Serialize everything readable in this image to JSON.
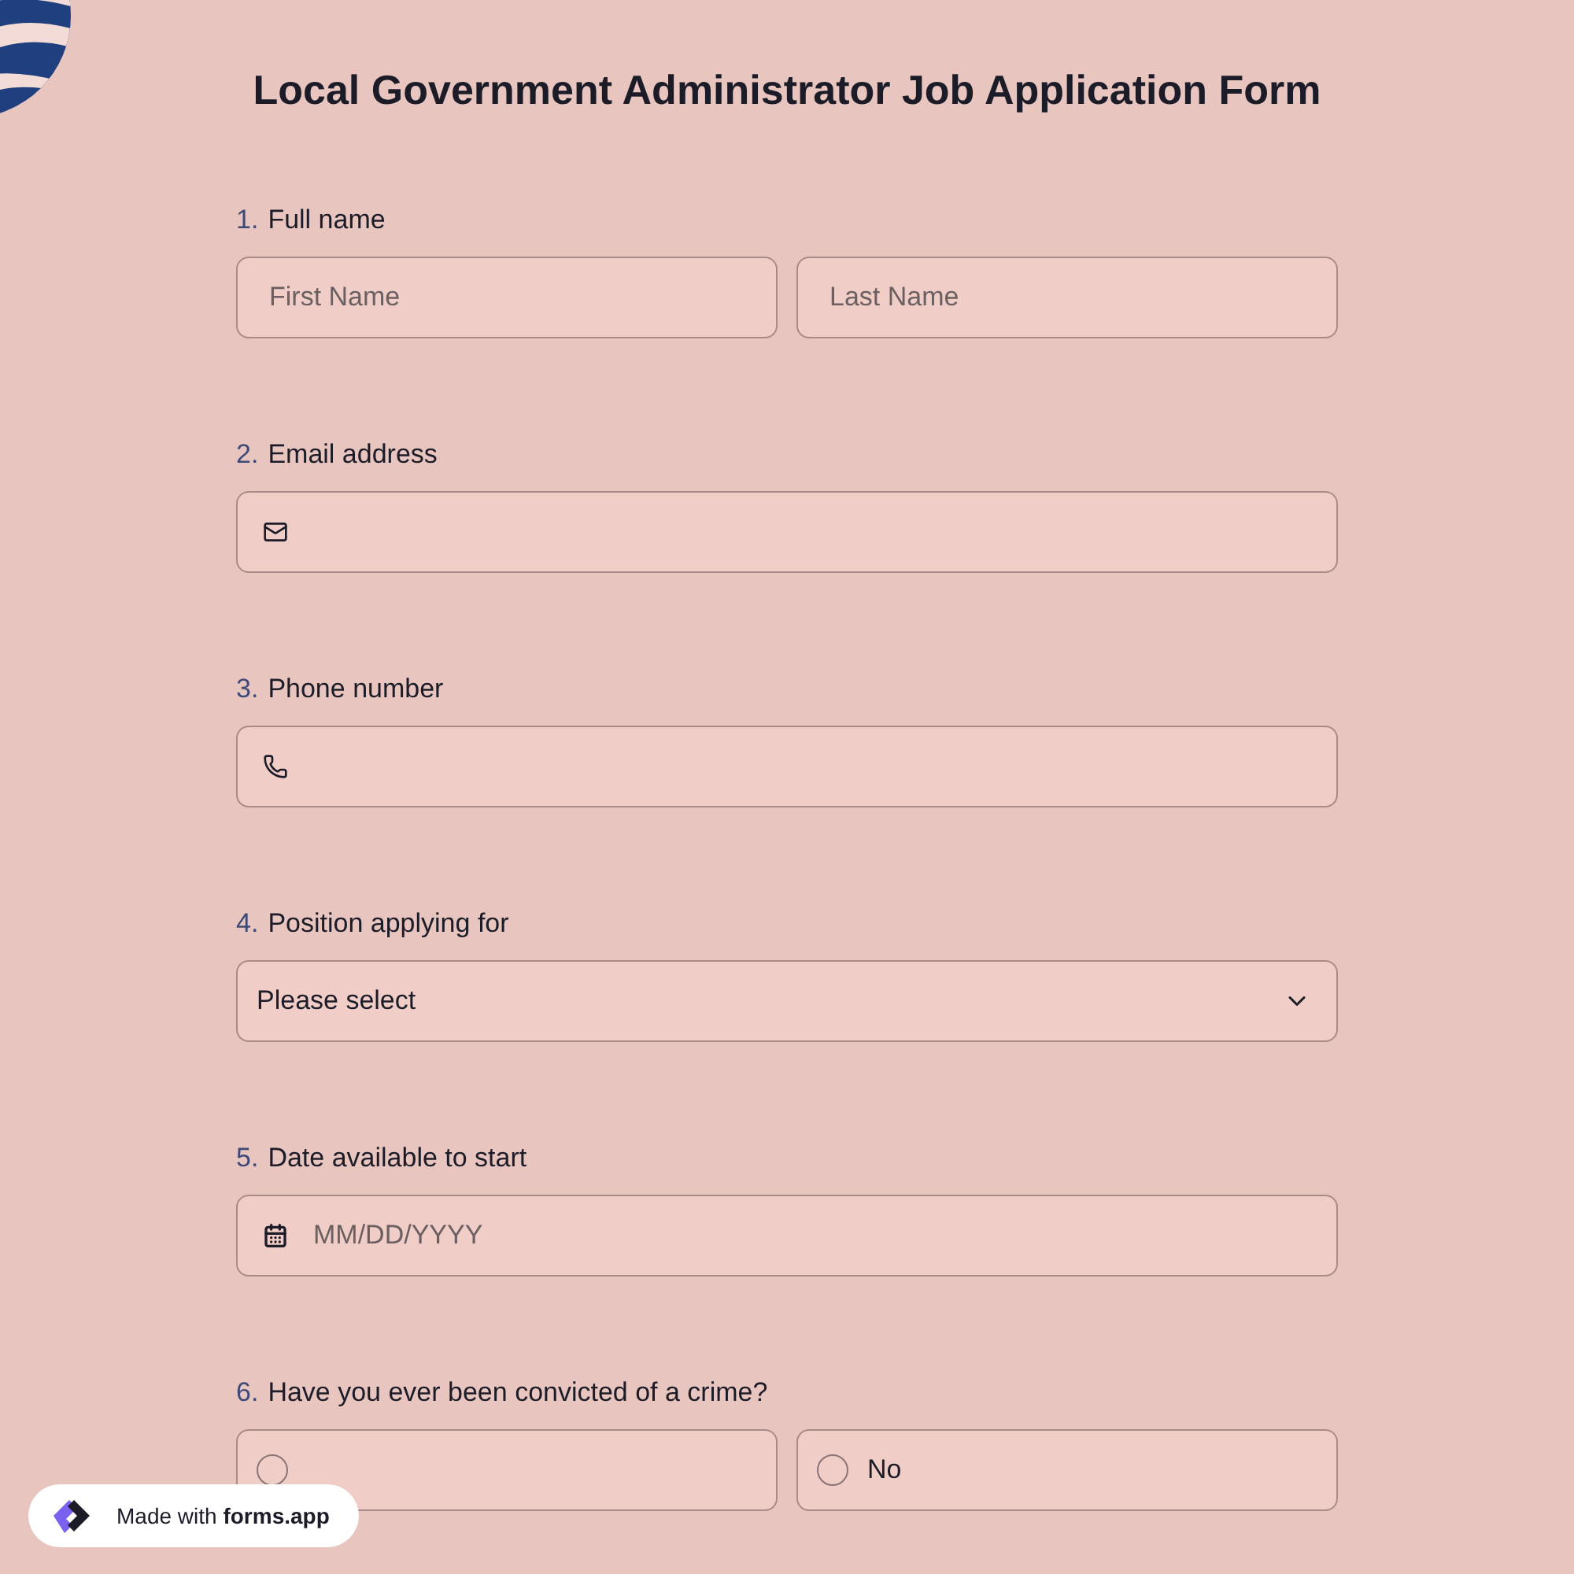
{
  "title": "Local Government Administrator Job Application Form",
  "questions": [
    {
      "number": "1.",
      "label": "Full name",
      "kind": "name",
      "fields": [
        {
          "placeholder": "First Name"
        },
        {
          "placeholder": "Last Name"
        }
      ]
    },
    {
      "number": "2.",
      "label": "Email address",
      "kind": "email"
    },
    {
      "number": "3.",
      "label": "Phone number",
      "kind": "phone"
    },
    {
      "number": "4.",
      "label": "Position applying for",
      "kind": "select",
      "value": "Please select"
    },
    {
      "number": "5.",
      "label": "Date available to start",
      "kind": "date",
      "placeholder": "MM/DD/YYYY"
    },
    {
      "number": "6.",
      "label": "Have you ever been convicted of a crime?",
      "kind": "radio",
      "options": [
        {
          "selected": false
        },
        {
          "label": "No",
          "selected": false
        }
      ]
    }
  ],
  "badge": {
    "prefix": "Made with",
    "brand": "forms.app"
  }
}
